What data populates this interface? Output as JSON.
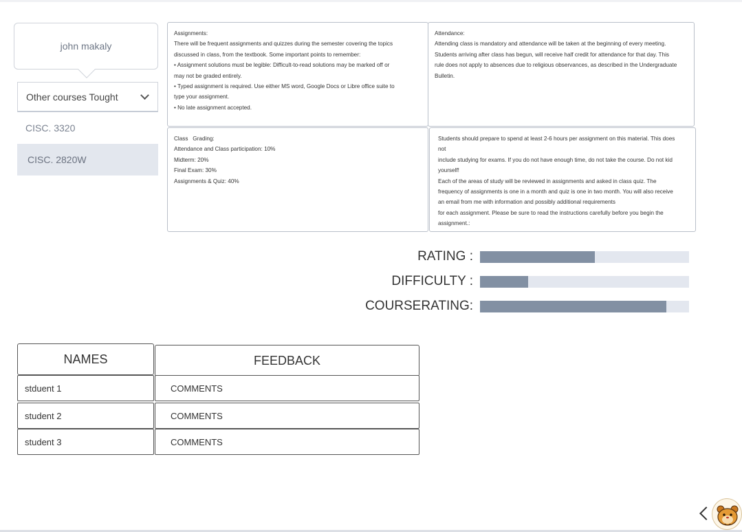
{
  "profile": {
    "name": "john makaly"
  },
  "courses": {
    "dropdown_label": "Other courses Tought",
    "items": [
      {
        "label": "CISC. 3320",
        "selected": false
      },
      {
        "label": "CISC. 2820W",
        "selected": true
      }
    ]
  },
  "info": {
    "assignments": [
      "Assignments:",
      "There will be frequent assignments and quizzes during the semester covering the topics",
      "discussed in class, from the textbook. Some important points to remember:",
      "• Assignment solutions must be legible: Difficult-to-read solutions may be marked off or",
      "may not be graded entirely.",
      "• Typed assignment is required. Use either MS word, Google Docs or Libre office suite to",
      "type your assignment.",
      "• No late assignment accepted."
    ],
    "attendance": [
      "Attendance:",
      "Attending class is mandatory and attendance will be taken at the beginning of every meeting.",
      "Students arriving after class has begun, will receive half credit for attendance for that day. This",
      "rule does not apply to absences due to religious observances, as described in the Undergraduate",
      "Bulletin."
    ],
    "grading": [
      "Class   Grading:",
      "Attendance and Class participation: 10%",
      "Midterm: 20%",
      "Final Exam: 30%",
      "Assignments & Quiz: 40%"
    ],
    "study": [
      "Students should prepare to spend at least 2-6 hours per assignment on this material. This does",
      "not",
      "include studying for exams. If you do not have enough time, do not take the course. Do not kid",
      "yourself!",
      "Each of the areas of study will be reviewed in assignments and asked in class quiz. The",
      "frequency of assignments is one in a month and quiz is one in two month. You will also receive",
      "an email from me with information and possibly additional requirements",
      "for each assignment. Please be sure to read the instructions carefully before you begin the",
      "assignment.:"
    ]
  },
  "ratings": [
    {
      "label": "RATING :",
      "value": 0.55
    },
    {
      "label": "DIFFICULTY :",
      "value": 0.23
    },
    {
      "label": "COURSERATING:",
      "value": 0.89
    }
  ],
  "table": {
    "headers": {
      "names": "NAMES",
      "feedback": "FEEDBACK"
    },
    "rows": [
      {
        "name": "stduent 1",
        "comment": "COMMENTS"
      },
      {
        "name": "student 2",
        "comment": "COMMENTS"
      },
      {
        "name": "student 3",
        "comment": "COMMENTS"
      }
    ]
  },
  "colors": {
    "rating_fill": "#8290a3",
    "rating_track": "#e3e7ef",
    "selected_course_bg": "#e3e7ee"
  },
  "icons": {
    "dropdown": "chevron-down-icon",
    "back": "chevron-left-icon",
    "mascot": "hamster-mascot-icon"
  }
}
